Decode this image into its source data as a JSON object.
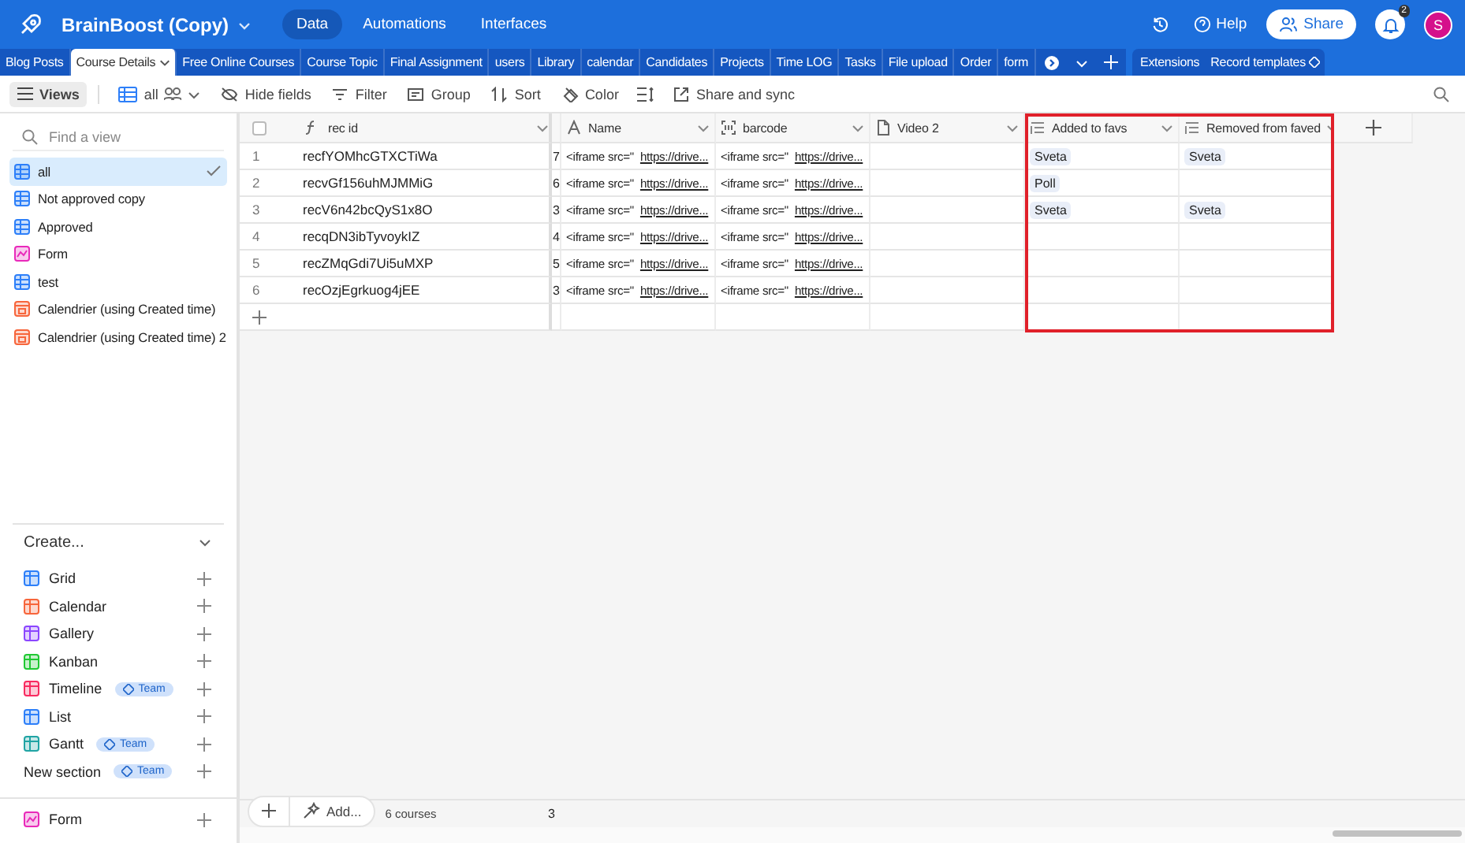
{
  "topbar": {
    "base_name": "BrainBoost (Copy)",
    "nav": [
      {
        "label": "Data",
        "selected": true
      },
      {
        "label": "Automations",
        "selected": false
      },
      {
        "label": "Interfaces",
        "selected": false
      }
    ],
    "help": "Help",
    "share": "Share",
    "notification_count": "2",
    "avatar": "S"
  },
  "tables": [
    {
      "label": "Blog Posts",
      "selected": false
    },
    {
      "label": "Course Details",
      "selected": true
    },
    {
      "label": "Free Online Courses",
      "selected": false
    },
    {
      "label": "Course Topic",
      "selected": false
    },
    {
      "label": "Final Assignment",
      "selected": false
    },
    {
      "label": "users",
      "selected": false
    },
    {
      "label": "Library",
      "selected": false
    },
    {
      "label": "calendar",
      "selected": false
    },
    {
      "label": "Candidates",
      "selected": false
    },
    {
      "label": "Projects",
      "selected": false
    },
    {
      "label": "Time LOG",
      "selected": false
    },
    {
      "label": "Tasks",
      "selected": false
    },
    {
      "label": "File upload",
      "selected": false
    },
    {
      "label": "Order",
      "selected": false
    },
    {
      "label": "form",
      "selected": false
    }
  ],
  "table_actions": {
    "extensions": "Extensions",
    "record_templates": "Record templates"
  },
  "toolbar": {
    "views": "Views",
    "view_name": "all",
    "items": [
      "Hide fields",
      "Filter",
      "Group",
      "Sort",
      "Color"
    ],
    "share_sync": "Share and sync"
  },
  "sidebar": {
    "search": {
      "placeholder": "Find a view"
    },
    "views": [
      {
        "label": "all",
        "kind": "grid",
        "selected": true
      },
      {
        "label": "Not approved copy",
        "kind": "grid",
        "selected": false
      },
      {
        "label": "Approved",
        "kind": "grid",
        "selected": false
      },
      {
        "label": "Form",
        "kind": "form",
        "selected": false
      },
      {
        "label": "test",
        "kind": "grid",
        "selected": false
      },
      {
        "label": "Calendrier (using Created time)",
        "kind": "calendar",
        "selected": false
      },
      {
        "label": "Calendrier (using Created time) 2",
        "kind": "calendar",
        "selected": false
      }
    ],
    "create_title": "Create...",
    "create": [
      {
        "label": "Grid",
        "kind": "grid"
      },
      {
        "label": "Calendar",
        "kind": "calendar"
      },
      {
        "label": "Gallery",
        "kind": "gallery"
      },
      {
        "label": "Kanban",
        "kind": "kanban"
      },
      {
        "label": "Timeline",
        "kind": "timeline",
        "badge": "Team"
      },
      {
        "label": "List",
        "kind": "list"
      },
      {
        "label": "Gantt",
        "kind": "gantt",
        "badge": "Team"
      },
      {
        "label": "New section",
        "kind": "section",
        "badge": "Team"
      }
    ],
    "bottom": [
      {
        "label": "Form",
        "kind": "form"
      }
    ]
  },
  "grid": {
    "select_all_checked": false,
    "primary": {
      "name": "rec id",
      "kind": "formula"
    },
    "columns": [
      {
        "name": "Name",
        "kind": "text",
        "highlighted": false
      },
      {
        "name": "barcode",
        "kind": "barcode",
        "highlighted": false
      },
      {
        "name": "Video 2",
        "kind": "document",
        "highlighted": false
      },
      {
        "name": "Added to favs",
        "kind": "lookup",
        "highlighted": true
      },
      {
        "name": "Removed from faved",
        "kind": "lookup",
        "highlighted": true
      }
    ],
    "rows": [
      {
        "number": "1",
        "rec_id": "recfYOMhcGTXCTiWa",
        "column_3": "7",
        "cells": [
          {
            "kind": "iframe",
            "prefix": "<iframe src=\"",
            "link": "https://drive..."
          },
          {
            "kind": "iframe",
            "prefix": "<iframe src=\"",
            "link": "https://drive..."
          },
          {
            "kind": "empty"
          },
          {
            "kind": "tags",
            "tags": [
              "Sveta"
            ]
          },
          {
            "kind": "tags",
            "tags": [
              "Sveta"
            ]
          }
        ]
      },
      {
        "number": "2",
        "rec_id": "recvGf156uhMJMMiG",
        "column_3": "6",
        "cells": [
          {
            "kind": "iframe",
            "prefix": "<iframe src=\"",
            "link": "https://drive..."
          },
          {
            "kind": "iframe",
            "prefix": "<iframe src=\"",
            "link": "https://drive..."
          },
          {
            "kind": "empty"
          },
          {
            "kind": "tags",
            "tags": [
              "Poll"
            ]
          },
          {
            "kind": "empty"
          }
        ]
      },
      {
        "number": "3",
        "rec_id": "recV6n42bcQyS1x8O",
        "column_3": "3",
        "cells": [
          {
            "kind": "iframe",
            "prefix": "<iframe src=\"",
            "link": "https://drive..."
          },
          {
            "kind": "iframe",
            "prefix": "<iframe src=\"",
            "link": "https://drive..."
          },
          {
            "kind": "empty"
          },
          {
            "kind": "tags",
            "tags": [
              "Sveta"
            ]
          },
          {
            "kind": "tags",
            "tags": [
              "Sveta"
            ]
          }
        ]
      },
      {
        "number": "4",
        "rec_id": "recqDN3ibTyvoykIZ",
        "column_3": "4",
        "cells": [
          {
            "kind": "iframe",
            "prefix": "<iframe src=\"",
            "link": "https://drive..."
          },
          {
            "kind": "iframe",
            "prefix": "<iframe src=\"",
            "link": "https://drive..."
          },
          {
            "kind": "empty"
          },
          {
            "kind": "empty"
          },
          {
            "kind": "empty"
          }
        ]
      },
      {
        "number": "5",
        "rec_id": "recZMqGdi7Ui5uMXP",
        "column_3": "5",
        "cells": [
          {
            "kind": "iframe",
            "prefix": "<iframe src=\"",
            "link": "https://drive..."
          },
          {
            "kind": "iframe",
            "prefix": "<iframe src=\"",
            "link": "https://drive..."
          },
          {
            "kind": "empty"
          },
          {
            "kind": "empty"
          },
          {
            "kind": "empty"
          }
        ]
      },
      {
        "number": "6",
        "rec_id": "recOzjEgrkuog4jEE",
        "column_3": "3",
        "cells": [
          {
            "kind": "iframe",
            "prefix": "<iframe src=\"",
            "link": "https://drive..."
          },
          {
            "kind": "iframe",
            "prefix": "<iframe src=\"",
            "link": "https://drive..."
          },
          {
            "kind": "empty"
          },
          {
            "kind": "empty"
          },
          {
            "kind": "empty"
          }
        ]
      }
    ],
    "footer": {
      "add": "Add...",
      "count": "6 courses",
      "column_3": "3"
    }
  }
}
